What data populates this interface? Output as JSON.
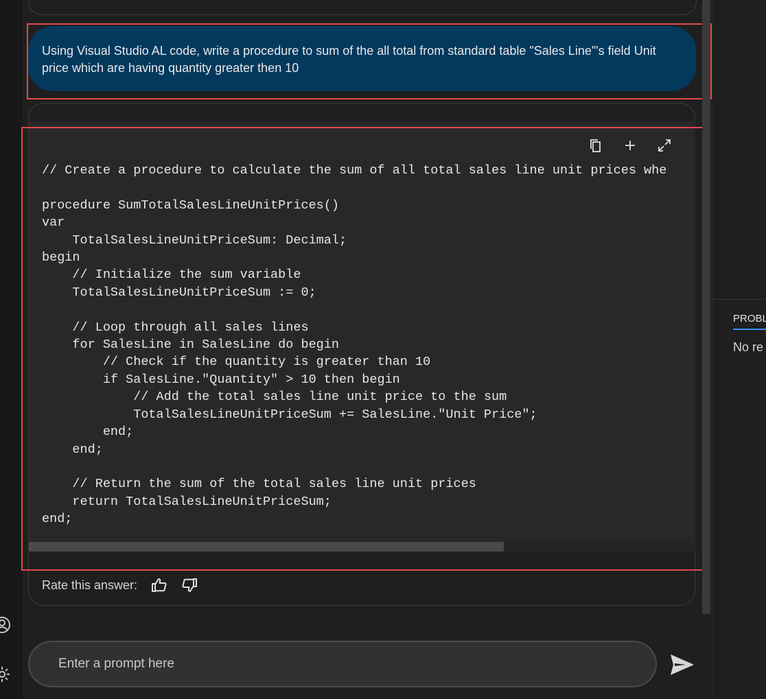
{
  "user_message": "Using Visual Studio AL code, write a procedure to sum of the all total from standard table \"Sales Line\"'s field Unit price which are having quantity greater then 10",
  "code": "// Create a procedure to calculate the sum of all total sales line unit prices whe\n\nprocedure SumTotalSalesLineUnitPrices()\nvar\n    TotalSalesLineUnitPriceSum: Decimal;\nbegin\n    // Initialize the sum variable\n    TotalSalesLineUnitPriceSum := 0;\n\n    // Loop through all sales lines\n    for SalesLine in SalesLine do begin\n        // Check if the quantity is greater than 10\n        if SalesLine.\"Quantity\" > 10 then begin\n            // Add the total sales line unit price to the sum\n            TotalSalesLineUnitPriceSum += SalesLine.\"Unit Price\";\n        end;\n    end;\n\n    // Return the sum of the total sales line unit prices\n    return TotalSalesLineUnitPriceSum;\nend;",
  "code_toolbar": {
    "copy_icon": "copy-icon",
    "insert_icon": "plus-icon",
    "expand_icon": "expand-icon"
  },
  "rating": {
    "label": "Rate this answer:",
    "thumbs_up_icon": "thumbs-up-icon",
    "thumbs_down_icon": "thumbs-down-icon"
  },
  "prompt": {
    "placeholder": "Enter a prompt here",
    "send_icon": "send-icon"
  },
  "activity_bar": {
    "account_icon": "account-icon",
    "settings_icon": "gear-icon"
  },
  "right_panel": {
    "tab_label": "PROBL",
    "message": "No re"
  },
  "colors": {
    "user_bubble": "#04395e",
    "highlight": "#e5484d",
    "code_bg": "#282828",
    "panel_tab_accent": "#3794ff"
  }
}
